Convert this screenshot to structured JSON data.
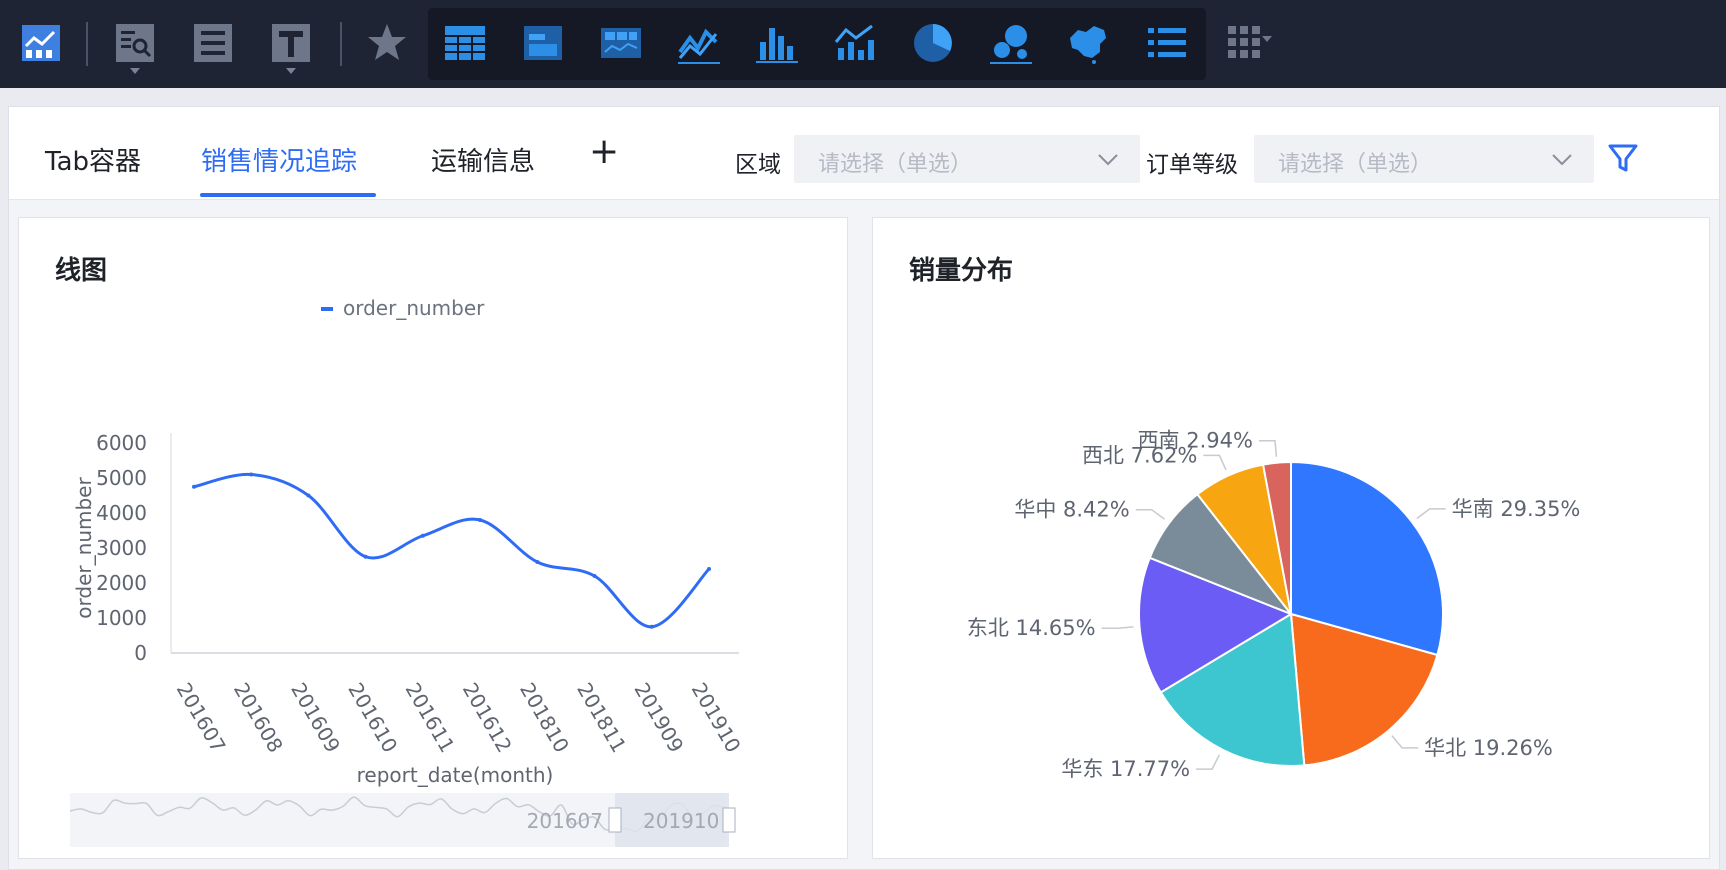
{
  "toolbar": {
    "icons": [
      "dashboard-icon",
      "query-icon",
      "report-icon",
      "text-icon",
      "favorite-icon",
      "table-icon",
      "tab-container-icon",
      "kpi-chart-icon",
      "line-chart-icon",
      "bar-chart-icon",
      "combo-chart-icon",
      "pie-chart-icon",
      "bubble-chart-icon",
      "china-map-icon",
      "list-icon",
      "more-icon"
    ]
  },
  "tabs": [
    {
      "label": "Tab容器",
      "active": false
    },
    {
      "label": "销售情况追踪",
      "active": true
    },
    {
      "label": "运输信息",
      "active": false
    }
  ],
  "add_tab_label": "+",
  "filters": [
    {
      "label": "区域",
      "placeholder": "请选择（单选）"
    },
    {
      "label": "订单等级",
      "placeholder": "请选择（单选）"
    }
  ],
  "accent_color": "#2f6cf6",
  "line_card": {
    "title": "线图"
  },
  "pie_card": {
    "title": "销量分布"
  },
  "chart_data": [
    {
      "type": "line",
      "title": "线图",
      "legend": [
        "order_number"
      ],
      "xlabel": "report_date(month)",
      "ylabel": "order_number",
      "categories": [
        "201607",
        "201608",
        "201609",
        "201610",
        "201611",
        "201612",
        "201810",
        "201811",
        "201909",
        "201910"
      ],
      "series": [
        {
          "name": "order_number",
          "values": [
            4750,
            5100,
            4500,
            2750,
            3350,
            3800,
            2600,
            2200,
            750,
            2400
          ],
          "color": "#2f6cf6"
        }
      ],
      "ylim": [
        0,
        6000
      ],
      "yticks": [
        0,
        1000,
        2000,
        3000,
        4000,
        5000,
        6000
      ],
      "slider": {
        "start_label": "201607",
        "end_label": "201910"
      }
    },
    {
      "type": "pie",
      "title": "销量分布",
      "slices": [
        {
          "name": "华南",
          "value": 29.35,
          "label": "华南 29.35%",
          "color": "#2f77ff"
        },
        {
          "name": "华北",
          "value": 19.26,
          "label": "华北 19.26%",
          "color": "#f86b1d"
        },
        {
          "name": "华东",
          "value": 17.77,
          "label": "华东 17.77%",
          "color": "#3dc6d0"
        },
        {
          "name": "东北",
          "value": 14.65,
          "label": "东北 14.65%",
          "color": "#6a5cf5"
        },
        {
          "name": "华中",
          "value": 8.42,
          "label": "华中 8.42%",
          "color": "#7a8c99"
        },
        {
          "name": "西北",
          "value": 7.62,
          "label": "西北 7.62%",
          "color": "#f8a512"
        },
        {
          "name": "西南",
          "value": 2.94,
          "label": "西南 2.94%",
          "color": "#d9645d"
        }
      ]
    }
  ]
}
